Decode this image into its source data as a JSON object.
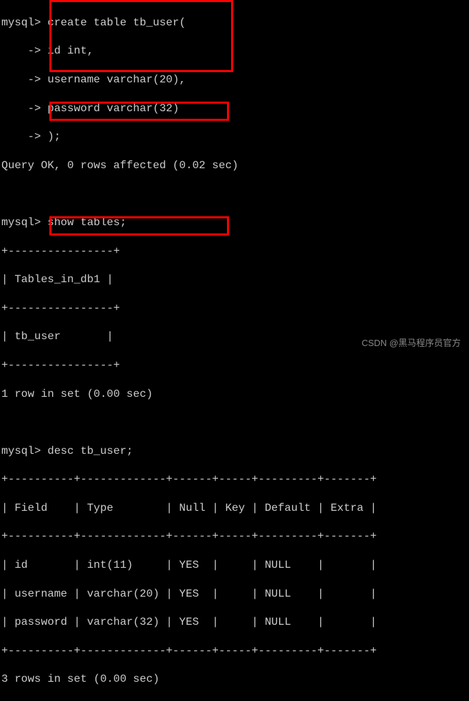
{
  "prompt": "mysql>",
  "continuation": "    ->",
  "commands": {
    "create_table": {
      "line1": " create table tb_user(",
      "line2": " id int,",
      "line3": " username varchar(20),",
      "line4": " password varchar(32)",
      "line5": " );"
    },
    "show_tables": " show tables;",
    "desc": " desc tb_user;"
  },
  "output": {
    "query_ok": "Query OK, 0 rows affected (0.02 sec)",
    "tables_border": "+----------------+",
    "tables_header": "| Tables_in_db1 |",
    "tables_row": "| tb_user       |",
    "one_row": "1 row in set (0.00 sec)",
    "desc_border": "+----------+-------------+------+-----+---------+-------+",
    "desc_header": "| Field    | Type        | Null | Key | Default | Extra |",
    "desc_row1": "| id       | int(11)     | YES  |     | NULL    |       |",
    "desc_row2": "| username | varchar(20) | YES  |     | NULL    |       |",
    "desc_row3": "| password | varchar(32) | YES  |     | NULL    |       |",
    "three_rows": "3 rows in set (0.00 sec)"
  },
  "watermark": "CSDN @黑马程序员官方",
  "chart_data": {
    "type": "table",
    "title": "desc tb_user",
    "columns": [
      "Field",
      "Type",
      "Null",
      "Key",
      "Default",
      "Extra"
    ],
    "rows": [
      [
        "id",
        "int(11)",
        "YES",
        "",
        "NULL",
        ""
      ],
      [
        "username",
        "varchar(20)",
        "YES",
        "",
        "NULL",
        ""
      ],
      [
        "password",
        "varchar(32)",
        "YES",
        "",
        "NULL",
        ""
      ]
    ]
  }
}
